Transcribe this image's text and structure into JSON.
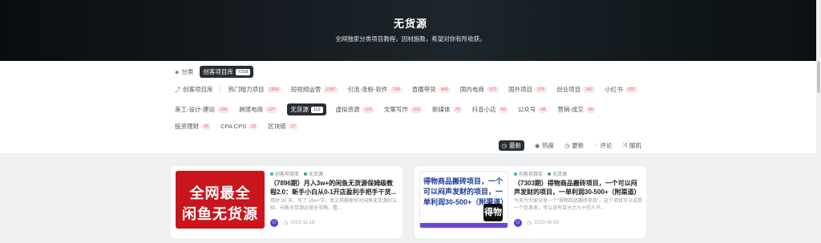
{
  "hero": {
    "title": "无货源",
    "subtitle": "全网独家分类项目教程，因材施教，希望对你有所收获。"
  },
  "filter": {
    "category_label": "分类",
    "category_active": {
      "label": "创客项目库",
      "count": "7218"
    },
    "parent_label": "创客项目库",
    "row1": [
      {
        "label": "热门暗力项目",
        "count": "1965"
      },
      {
        "label": "短视频运营",
        "count": "1387"
      },
      {
        "label": "引流-涨粉-软件",
        "count": "734"
      },
      {
        "label": "直播带货",
        "count": "445"
      },
      {
        "label": "国内电商",
        "count": "372"
      },
      {
        "label": "国外项目",
        "count": "275"
      },
      {
        "label": "创业项目",
        "count": "247"
      },
      {
        "label": "小红书",
        "count": "202"
      }
    ],
    "row2": [
      {
        "label": "美工-设计-建站",
        "count": "188"
      },
      {
        "label": "跨境电商",
        "count": "127"
      },
      {
        "label": "无货源",
        "count": "112",
        "active": true
      },
      {
        "label": "虚拟资源",
        "count": "109"
      },
      {
        "label": "文案写作",
        "count": "103"
      },
      {
        "label": "新媒体",
        "count": "78"
      },
      {
        "label": "抖音小店",
        "count": "58"
      },
      {
        "label": "公众号",
        "count": "48"
      },
      {
        "label": "营销-成交",
        "count": "46"
      }
    ],
    "row3": [
      {
        "label": "投资理财",
        "count": "36"
      },
      {
        "label": "CPA CPS",
        "count": "23"
      },
      {
        "label": "区块链",
        "count": "17"
      }
    ]
  },
  "sort": {
    "newest": "最新",
    "hot": "热度",
    "updated": "更新",
    "comments": "评论",
    "random": "随机"
  },
  "posts": [
    {
      "thumb_text_1": "全网最全",
      "thumb_text_2": "闲鱼无货源",
      "cat1": "创客项目库",
      "cat2": "无货源",
      "title": "（7896期）月入3w+的闲鱼无货源保姆级教程2.0：新手小白从0-1开店盈利手把手干货...",
      "desc": "用时 30 天，写了 19w+字，本文将删斯份对闲鱼无货源的认知、闲鱼无货源运营全攻略，看...",
      "date": "2023-11-18"
    },
    {
      "thumb_text": "得物商品搬砖项目，一个可以闷声发财的项目，一单利润30-500+（附渠道）",
      "thumb_logo": "得物",
      "cat1": "创客项目库",
      "cat2": "无货源",
      "title": "（7303期）得物商品搬砖项目，一个可以闷声发财的项目，一单利润30-500+（附渠道）",
      "desc": "今天为大家分享一个“得物商品搬砖项目”，这个项目可以说是一个信息差，可以说有百分之九十的人不...",
      "date": "2023-09-19"
    }
  ],
  "colors": {
    "accent_dark": "#2a2f35",
    "count_badge": "#e06b6b",
    "cat_dot_1": "#2bb3c0",
    "cat_dot_2": "#3da35d"
  }
}
